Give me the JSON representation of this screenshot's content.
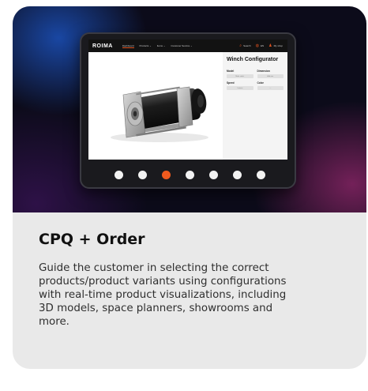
{
  "card": {
    "title": "CPQ + Order",
    "description": "Guide the customer in selecting the correct products/product variants using configurations with real-time product visualizations, including 3D models, space planners, showrooms and more."
  },
  "app": {
    "logo": "ROIMA",
    "nav": [
      {
        "label": "Dashboard"
      },
      {
        "label": "Products ⌄"
      },
      {
        "label": "Items ⌄"
      },
      {
        "label": "Customer Service ⌄"
      }
    ],
    "utils": [
      {
        "label": "Search",
        "icon": "search-icon"
      },
      {
        "label": "EN",
        "icon": "globe-icon"
      },
      {
        "label": "My shop",
        "icon": "user-icon"
      }
    ],
    "configurator": {
      "title": "Winch Configurator",
      "options": [
        {
          "label": "Model",
          "value": "Make select"
        },
        {
          "label": "Dimension",
          "value": "Add size"
        },
        {
          "label": "Speed",
          "value": "0 m/min"
        },
        {
          "label": "Color",
          "value": "—"
        }
      ]
    }
  },
  "carousel": {
    "count": 7,
    "active_index": 2
  },
  "colors": {
    "accent": "#f05a1e",
    "card_bg": "#e9e9e9",
    "hero_bg": "#0c0b1a"
  }
}
